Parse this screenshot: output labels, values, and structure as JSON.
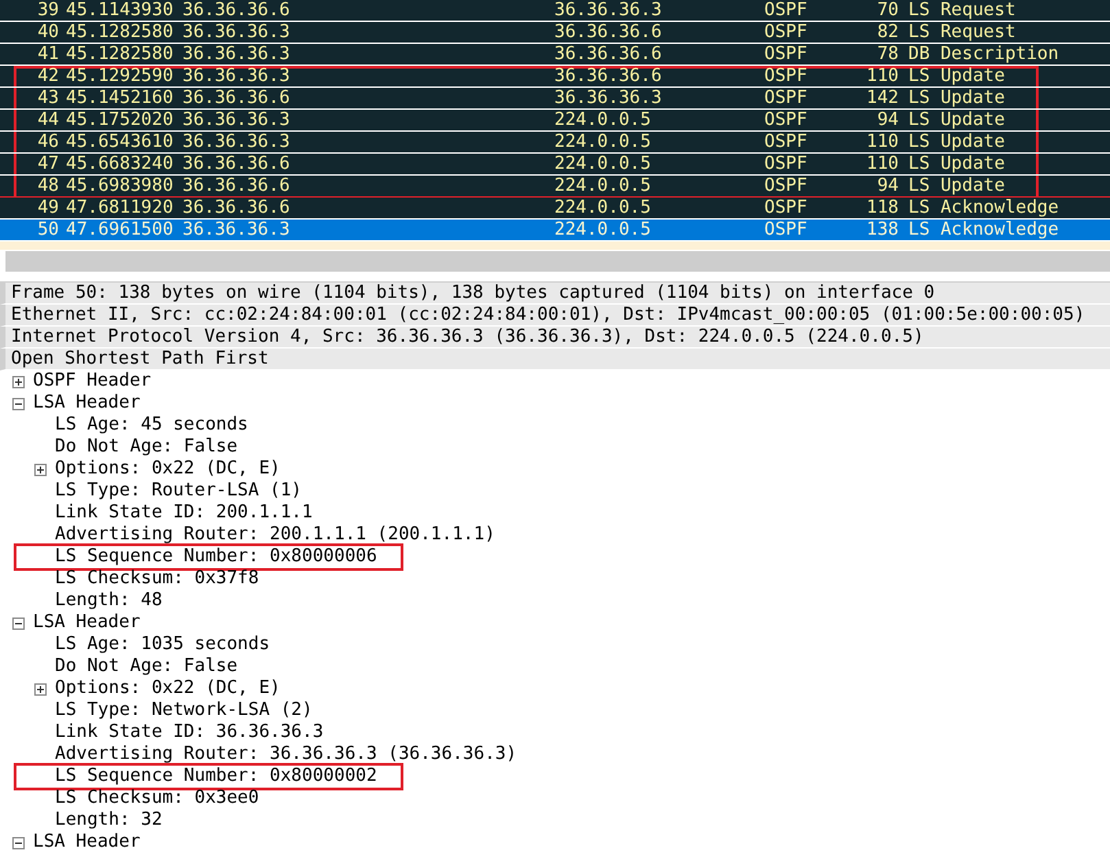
{
  "packet_list": {
    "rows": [
      {
        "no": "39",
        "time": "45.1143930",
        "source": "36.36.36.6",
        "destination": "36.36.36.3",
        "protocol": "OSPF",
        "length": "70",
        "info": "LS Request",
        "selected": false,
        "boxed": false
      },
      {
        "no": "40",
        "time": "45.1282580",
        "source": "36.36.36.3",
        "destination": "36.36.36.6",
        "protocol": "OSPF",
        "length": "82",
        "info": "LS Request",
        "selected": false,
        "boxed": false
      },
      {
        "no": "41",
        "time": "45.1282580",
        "source": "36.36.36.3",
        "destination": "36.36.36.6",
        "protocol": "OSPF",
        "length": "78",
        "info": "DB Description",
        "selected": false,
        "boxed": false
      },
      {
        "no": "42",
        "time": "45.1292590",
        "source": "36.36.36.3",
        "destination": "36.36.36.6",
        "protocol": "OSPF",
        "length": "110",
        "info": "LS Update",
        "selected": false,
        "boxed": true
      },
      {
        "no": "43",
        "time": "45.1452160",
        "source": "36.36.36.6",
        "destination": "36.36.36.3",
        "protocol": "OSPF",
        "length": "142",
        "info": "LS Update",
        "selected": false,
        "boxed": true
      },
      {
        "no": "44",
        "time": "45.1752020",
        "source": "36.36.36.3",
        "destination": "224.0.0.5",
        "protocol": "OSPF",
        "length": "94",
        "info": "LS Update",
        "selected": false,
        "boxed": true
      },
      {
        "no": "46",
        "time": "45.6543610",
        "source": "36.36.36.3",
        "destination": "224.0.0.5",
        "protocol": "OSPF",
        "length": "110",
        "info": "LS Update",
        "selected": false,
        "boxed": true
      },
      {
        "no": "47",
        "time": "45.6683240",
        "source": "36.36.36.6",
        "destination": "224.0.0.5",
        "protocol": "OSPF",
        "length": "110",
        "info": "LS Update",
        "selected": false,
        "boxed": true
      },
      {
        "no": "48",
        "time": "45.6983980",
        "source": "36.36.36.6",
        "destination": "224.0.0.5",
        "protocol": "OSPF",
        "length": "94",
        "info": "LS Update",
        "selected": false,
        "boxed": true
      },
      {
        "no": "49",
        "time": "47.6811920",
        "source": "36.36.36.6",
        "destination": "224.0.0.5",
        "protocol": "OSPF",
        "length": "118",
        "info": "LS Acknowledge",
        "selected": false,
        "boxed": false
      },
      {
        "no": "50",
        "time": "47.6961500",
        "source": "36.36.36.3",
        "destination": "224.0.0.5",
        "protocol": "OSPF",
        "length": "138",
        "info": "LS Acknowledge",
        "selected": true,
        "boxed": false
      }
    ]
  },
  "details": {
    "items": [
      {
        "text": "Frame 50: 138 bytes on wire (1104 bits), 138 bytes captured (1104 bits) on interface 0"
      },
      {
        "text": "Ethernet II, Src: cc:02:24:84:00:01 (cc:02:24:84:00:01), Dst: IPv4mcast_00:00:05 (01:00:5e:00:00:05)"
      },
      {
        "text": "Internet Protocol Version 4, Src: 36.36.36.3 (36.36.36.3), Dst: 224.0.0.5 (224.0.0.5)"
      },
      {
        "text": "Open Shortest Path First",
        "children": [
          {
            "text": "OSPF Header",
            "expanded": false
          },
          {
            "text": "LSA Header",
            "expanded": true,
            "children": [
              {
                "text": "LS Age: 45 seconds"
              },
              {
                "text": "Do Not Age: False"
              },
              {
                "text": "Options: 0x22 (DC, E)",
                "expanded": false
              },
              {
                "text": "LS Type: Router-LSA (1)"
              },
              {
                "text": "Link State ID: 200.1.1.1"
              },
              {
                "text": "Advertising Router: 200.1.1.1 (200.1.1.1)"
              },
              {
                "text": "LS Sequence Number: 0x80000006",
                "boxed": true
              },
              {
                "text": "LS Checksum: 0x37f8"
              },
              {
                "text": "Length: 48"
              }
            ]
          },
          {
            "text": "LSA Header",
            "expanded": true,
            "children": [
              {
                "text": "LS Age: 1035 seconds"
              },
              {
                "text": "Do Not Age: False"
              },
              {
                "text": "Options: 0x22 (DC, E)",
                "expanded": false
              },
              {
                "text": "LS Type: Network-LSA (2)"
              },
              {
                "text": "Link State ID: 36.36.36.3"
              },
              {
                "text": "Advertising Router: 36.36.36.3 (36.36.36.3)"
              },
              {
                "text": "LS Sequence Number: 0x80000002",
                "boxed": true
              },
              {
                "text": "LS Checksum: 0x3ee0"
              },
              {
                "text": "Length: 32"
              }
            ]
          },
          {
            "text": "LSA Header",
            "expanded": true
          }
        ]
      }
    ]
  }
}
